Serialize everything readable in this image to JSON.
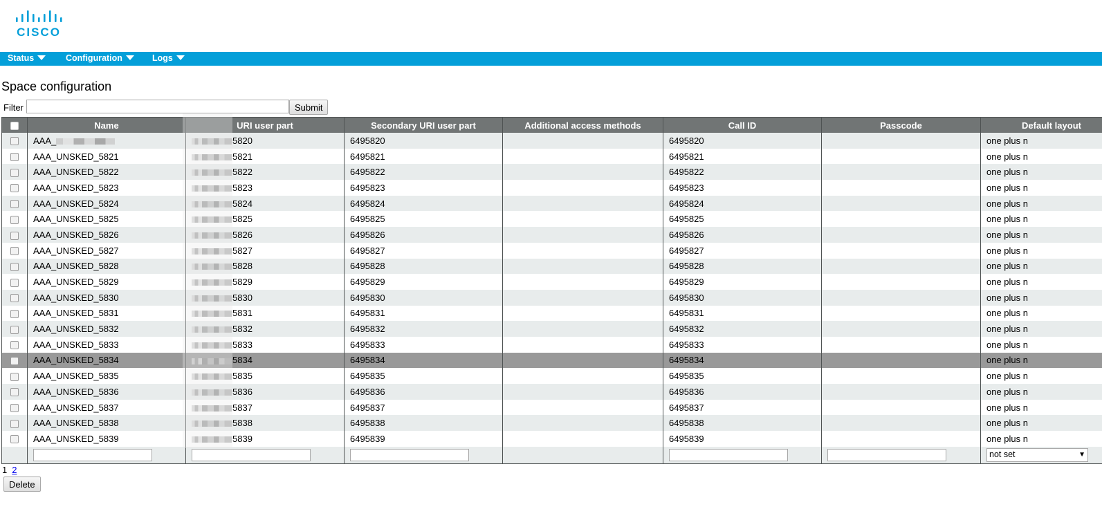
{
  "brand": {
    "logo_text": "CISCO",
    "color": "#049fd9"
  },
  "nav": [
    {
      "label": "Status"
    },
    {
      "label": "Configuration"
    },
    {
      "label": "Logs"
    }
  ],
  "page_title": "Space configuration",
  "filter": {
    "label": "Filter",
    "value": "",
    "submit_label": "Submit"
  },
  "table": {
    "columns": [
      "Name",
      "URI user part",
      "Secondary URI user part",
      "Additional access methods",
      "Call ID",
      "Passcode",
      "Default layout"
    ],
    "rows": [
      {
        "name": "AAA_",
        "uri_suffix": "5820",
        "secondary": "6495820",
        "call_id": "6495820",
        "layout": "one plus n",
        "name_redacted": true
      },
      {
        "name": "AAA_UNSKED_5821",
        "uri_suffix": "5821",
        "secondary": "6495821",
        "call_id": "6495821",
        "layout": "one plus n"
      },
      {
        "name": "AAA_UNSKED_5822",
        "uri_suffix": "5822",
        "secondary": "6495822",
        "call_id": "6495822",
        "layout": "one plus n"
      },
      {
        "name": "AAA_UNSKED_5823",
        "uri_suffix": "5823",
        "secondary": "6495823",
        "call_id": "6495823",
        "layout": "one plus n"
      },
      {
        "name": "AAA_UNSKED_5824",
        "uri_suffix": "5824",
        "secondary": "6495824",
        "call_id": "6495824",
        "layout": "one plus n"
      },
      {
        "name": "AAA_UNSKED_5825",
        "uri_suffix": "5825",
        "secondary": "6495825",
        "call_id": "6495825",
        "layout": "one plus n"
      },
      {
        "name": "AAA_UNSKED_5826",
        "uri_suffix": "5826",
        "secondary": "6495826",
        "call_id": "6495826",
        "layout": "one plus n"
      },
      {
        "name": "AAA_UNSKED_5827",
        "uri_suffix": "5827",
        "secondary": "6495827",
        "call_id": "6495827",
        "layout": "one plus n"
      },
      {
        "name": "AAA_UNSKED_5828",
        "uri_suffix": "5828",
        "secondary": "6495828",
        "call_id": "6495828",
        "layout": "one plus n"
      },
      {
        "name": "AAA_UNSKED_5829",
        "uri_suffix": "5829",
        "secondary": "6495829",
        "call_id": "6495829",
        "layout": "one plus n"
      },
      {
        "name": "AAA_UNSKED_5830",
        "uri_suffix": "5830",
        "secondary": "6495830",
        "call_id": "6495830",
        "layout": "one plus n"
      },
      {
        "name": "AAA_UNSKED_5831",
        "uri_suffix": "5831",
        "secondary": "6495831",
        "call_id": "6495831",
        "layout": "one plus n"
      },
      {
        "name": "AAA_UNSKED_5832",
        "uri_suffix": "5832",
        "secondary": "6495832",
        "call_id": "6495832",
        "layout": "one plus n"
      },
      {
        "name": "AAA_UNSKED_5833",
        "uri_suffix": "5833",
        "secondary": "6495833",
        "call_id": "6495833",
        "layout": "one plus n"
      },
      {
        "name": "AAA_UNSKED_5834",
        "uri_suffix": "5834",
        "secondary": "6495834",
        "call_id": "6495834",
        "layout": "one plus n",
        "selected": true
      },
      {
        "name": "AAA_UNSKED_5835",
        "uri_suffix": "5835",
        "secondary": "6495835",
        "call_id": "6495835",
        "layout": "one plus n"
      },
      {
        "name": "AAA_UNSKED_5836",
        "uri_suffix": "5836",
        "secondary": "6495836",
        "call_id": "6495836",
        "layout": "one plus n"
      },
      {
        "name": "AAA_UNSKED_5837",
        "uri_suffix": "5837",
        "secondary": "6495837",
        "call_id": "6495837",
        "layout": "one plus n"
      },
      {
        "name": "AAA_UNSKED_5838",
        "uri_suffix": "5838",
        "secondary": "6495838",
        "call_id": "6495838",
        "layout": "one plus n"
      },
      {
        "name": "AAA_UNSKED_5839",
        "uri_suffix": "5839",
        "secondary": "6495839",
        "call_id": "6495839",
        "layout": "one plus n"
      }
    ],
    "default_layout_filter": "not set"
  },
  "pagination": {
    "current": "1",
    "next": "2"
  },
  "delete_label": "Delete"
}
